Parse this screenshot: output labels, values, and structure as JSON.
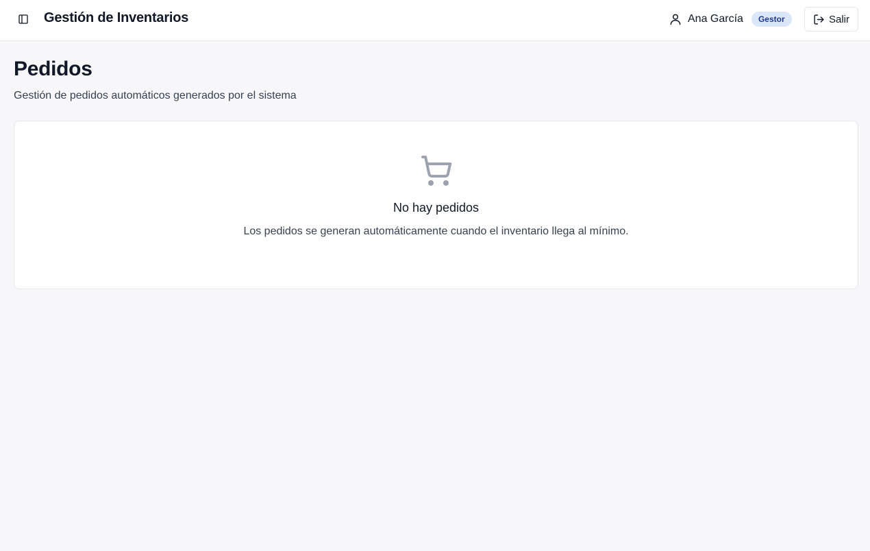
{
  "header": {
    "app_title": "Gestión de Inventarios",
    "user_name": "Ana García",
    "role_badge": "Gestor",
    "logout_label": "Salir",
    "icons": {
      "sidebar_toggle": "sidebar-toggle-icon",
      "user": "user-icon",
      "logout": "logout-icon"
    }
  },
  "page": {
    "title": "Pedidos",
    "subtitle": "Gestión de pedidos automáticos generados por el sistema"
  },
  "empty_state": {
    "icon": "shopping-cart-icon",
    "title": "No hay pedidos",
    "description": "Los pedidos se generan automáticamente cuando el inventario llega al mínimo."
  },
  "colors": {
    "background": "#f7f7f9",
    "badge_bg": "#dbe6fb",
    "badge_text": "#1e3a8a",
    "icon_muted": "#9ca3af"
  }
}
